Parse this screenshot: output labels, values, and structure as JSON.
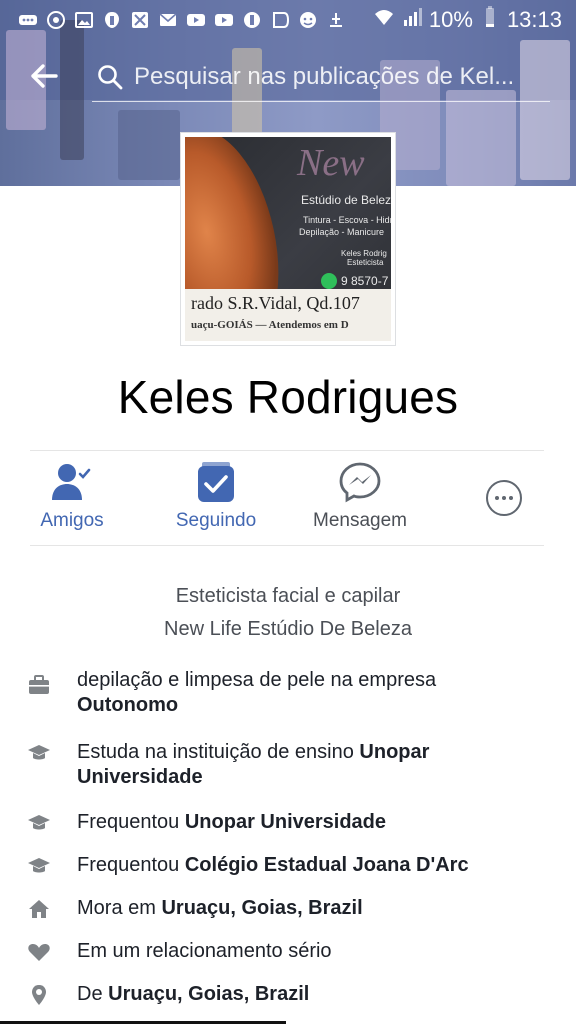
{
  "status_bar": {
    "battery": "10%",
    "time": "13:13",
    "notification_icons": [
      "more-icon",
      "sync-icon",
      "image-icon",
      "facebook-icon",
      "mail-icon",
      "mail-icon",
      "youtube-icon",
      "youtube-icon",
      "facebook-icon",
      "photo-icon",
      "face-icon",
      "warning-icon"
    ]
  },
  "search": {
    "placeholder": "Pesquisar nas publicações de Kel..."
  },
  "avatar_text": {
    "logo": "New",
    "line1": "Estúdio de Beleza",
    "line2": "Tintura - Escova - Hidratação",
    "line3": "Depilação - Manicure",
    "line4": "Keles Rodrig",
    "line5": "Esteticista",
    "phone": "9 8570-7",
    "band1": "rado S.R.Vidal, Qd.107",
    "band2": "uaçu-GOIÁS — Atendemos em D"
  },
  "profile": {
    "name": "Keles Rodrigues"
  },
  "actions": {
    "friends_label": "Amigos",
    "following_label": "Seguindo",
    "message_label": "Mensagem"
  },
  "bio": {
    "line1": "Esteticista facial e capilar",
    "line2": "New Life Estúdio De Beleza"
  },
  "details": [
    {
      "icon": "briefcase-icon",
      "prefix": "depilação e limpesa de pele na empresa",
      "bold": "Outonomo"
    },
    {
      "icon": "graduation-cap-icon",
      "prefix": "Estuda na instituição de ensino",
      "bold": "Unopar Universidade"
    },
    {
      "icon": "graduation-cap-icon",
      "prefix": "Frequentou",
      "bold": "Unopar Universidade"
    },
    {
      "icon": "graduation-cap-icon",
      "prefix": "Frequentou",
      "bold": "Colégio Estadual Joana D'Arc"
    },
    {
      "icon": "home-icon",
      "prefix": "Mora em",
      "bold": "Uruaçu, Goias, Brazil"
    },
    {
      "icon": "heart-icon",
      "prefix": "Em um relacionamento sério",
      "bold": ""
    },
    {
      "icon": "location-pin-icon",
      "prefix": "De",
      "bold": "Uruaçu, Goias, Brazil"
    }
  ],
  "colors": {
    "accent": "#4267b2",
    "text": "#1d2129",
    "secondary_text": "#4b4f56",
    "icon_gray": "#7f8387"
  }
}
